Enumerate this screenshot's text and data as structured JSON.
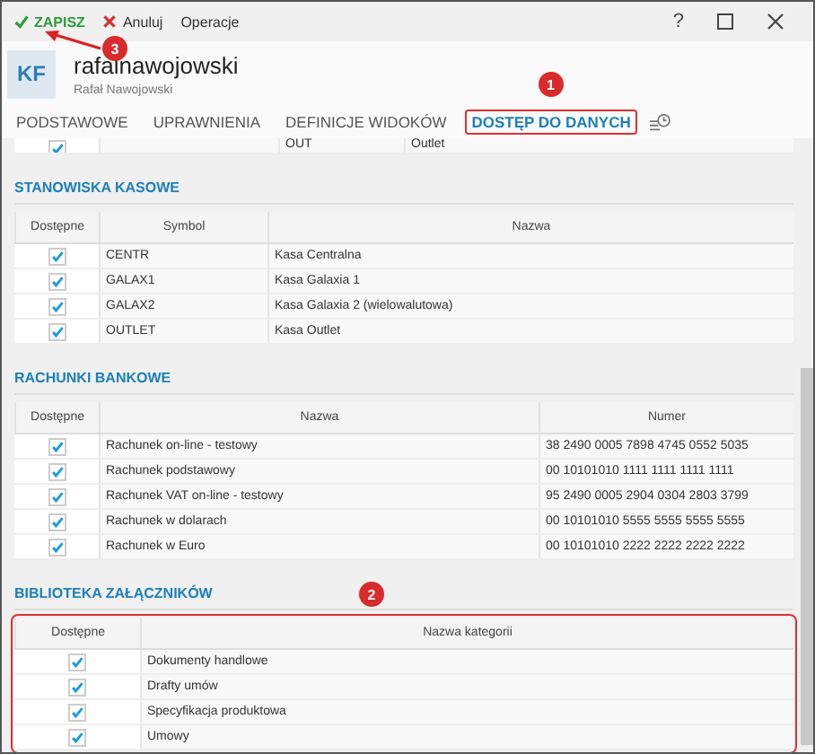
{
  "toolbar": {
    "actions": [
      {
        "kind": "save",
        "label": "ZAPISZ"
      },
      {
        "kind": "cancel",
        "label": "Anuluj"
      },
      {
        "kind": "plain",
        "label": "Operacje"
      }
    ],
    "help": "?"
  },
  "header": {
    "initials": "KF",
    "title": "rafalnawojowski",
    "subtitle": "Rafał Nawojowski"
  },
  "tabs": [
    {
      "label": "PODSTAWOWE",
      "selected": false,
      "highlighted": false
    },
    {
      "label": "UPRAWNIENIA",
      "selected": false,
      "highlighted": false
    },
    {
      "label": "DEFINICJE WIDOKÓW",
      "selected": false,
      "highlighted": false
    },
    {
      "label": "DOSTĘP DO DANYCH",
      "selected": true,
      "highlighted": true
    }
  ],
  "partial_row": {
    "checked": true,
    "cells": [
      "OUT",
      "Outlet"
    ]
  },
  "sections": [
    {
      "title": "STANOWISKA KASOWE",
      "highlighted": false,
      "columns": [
        "Dostępne",
        "Symbol",
        "Nazwa"
      ],
      "rows": [
        {
          "checked": true,
          "cells": [
            "CENTR",
            "Kasa Centralna"
          ]
        },
        {
          "checked": true,
          "cells": [
            "GALAX1",
            "Kasa Galaxia 1"
          ]
        },
        {
          "checked": true,
          "cells": [
            "GALAX2",
            "Kasa Galaxia 2 (wielowalutowa)"
          ]
        },
        {
          "checked": true,
          "cells": [
            "OUTLET",
            "Kasa Outlet"
          ]
        }
      ]
    },
    {
      "title": "RACHUNKI BANKOWE",
      "highlighted": false,
      "columns": [
        "Dostępne",
        "Nazwa",
        "Numer"
      ],
      "rows": [
        {
          "checked": true,
          "cells": [
            "Rachunek on-line - testowy",
            "38 2490 0005 7898 4745 0552 5035"
          ]
        },
        {
          "checked": true,
          "cells": [
            "Rachunek podstawowy",
            "00 10101010 1111 1111 1111 1111"
          ]
        },
        {
          "checked": true,
          "cells": [
            "Rachunek VAT on-line - testowy",
            "95 2490 0005 2904 0304 2803 3799"
          ]
        },
        {
          "checked": true,
          "cells": [
            "Rachunek w dolarach",
            "00 10101010 5555 5555 5555 5555"
          ]
        },
        {
          "checked": true,
          "cells": [
            "Rachunek w Euro",
            "00 10101010 2222 2222 2222 2222"
          ]
        }
      ]
    },
    {
      "title": "BIBLIOTEKA ZAŁĄCZNIKÓW",
      "highlighted": true,
      "columns": [
        "Dostępne",
        "Nazwa kategorii"
      ],
      "rows": [
        {
          "checked": true,
          "cells": [
            "Dokumenty handlowe"
          ]
        },
        {
          "checked": true,
          "cells": [
            "Drafty umów"
          ]
        },
        {
          "checked": true,
          "cells": [
            "Specyfikacja produktowa"
          ]
        },
        {
          "checked": true,
          "cells": [
            "Umowy"
          ]
        }
      ]
    }
  ],
  "annotations": [
    {
      "kind": "tab",
      "number": "1"
    },
    {
      "kind": "section",
      "number": "2"
    },
    {
      "kind": "save",
      "number": "3"
    }
  ]
}
